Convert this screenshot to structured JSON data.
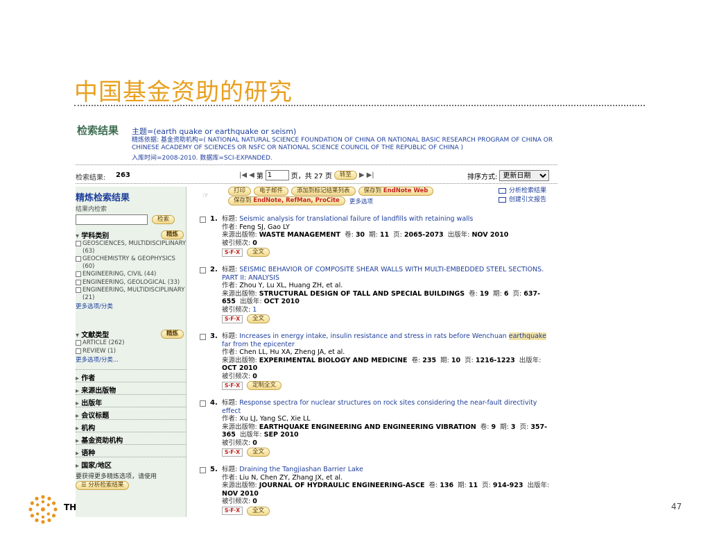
{
  "slide": {
    "title": "中国基金资助的研究",
    "logo_text": "TH",
    "page_number": "47"
  },
  "header": {
    "title": "检索结果",
    "topic": "主题=(earth quake or earthquake or seism)",
    "query": "精炼依据: 基金资助机构=( NATIONAL NATURAL SCIENCE FOUNDATION OF CHINA OR NATIONAL BASIC RESEARCH PROGRAM OF CHINA OR CHINESE ACADEMY OF SCIENCES OR NSFC OR NATIONAL SCIENCE COUNCIL OF THE REPUBLIC OF CHINA )",
    "timespan": "入库时间=2008-2010. 数据库=SCI-EXPANDED."
  },
  "results_bar": {
    "count_label": "检索结果:",
    "count": "263",
    "page_prefix": "第",
    "page_value": "1",
    "page_suffix": "页，共 27 页",
    "go_label": "转至",
    "sort_label": "排序方式:",
    "sort_value": "更新日期"
  },
  "sidebar": {
    "title": "精炼检索结果",
    "subtitle": "结果内检索",
    "search_button": "检索",
    "refine_button": "精炼",
    "subject": {
      "label": "学科类别",
      "items": [
        "GEOSCIENCES, MULTIDISCIPLINARY (63)",
        "GEOCHEMISTRY & GEOPHYSICS (60)",
        "ENGINEERING, CIVIL (44)",
        "ENGINEERING, GEOLOGICAL (33)",
        "ENGINEERING, MULTIDISCIPLINARY (21)"
      ],
      "more": "更多选项/分类"
    },
    "doctype": {
      "label": "文献类型",
      "items": [
        "ARTICLE (262)",
        "REVIEW (1)"
      ],
      "more": "更多选项/分类..."
    },
    "collapsed": [
      "作者",
      "来源出版物",
      "出版年",
      "会议标题",
      "机构",
      "基金资助机构",
      "语种",
      "国家/地区"
    ],
    "note": "要获得更多精炼选项，请使用",
    "analyze_button": "分析检索结果"
  },
  "actions": {
    "print": "打印",
    "email": "电子邮件",
    "add_marked": "添加到标记结果列表",
    "save_to": "保存到",
    "endnote_web": "EndNote Web",
    "save_to2": "保存到",
    "endnote_refman": "EndNote, RefMan, ProCite",
    "more_options": "更多选项",
    "analyze_results": "分析检索结果",
    "citation_report": "创建引文报告"
  },
  "labels": {
    "title": "标题:",
    "authors": "作者:",
    "source": "来源出版物:",
    "volume": "卷:",
    "issue": "期:",
    "pages": "页:",
    "year": "出版年:",
    "cited": "被引频次:",
    "sfx": "S·F·X",
    "fulltext": "全文",
    "custom_fulltext": "定制全文"
  },
  "records": [
    {
      "num": "1.",
      "title": "Seismic analysis for translational failure of landfills with retaining walls",
      "authors": "Feng SJ, Gao LY",
      "source": "WASTE MANAGEMENT",
      "volume": "30",
      "issue": "11",
      "pages": "2065-2073",
      "year": "NOV 2010",
      "cited": "0",
      "button": "全文"
    },
    {
      "num": "2.",
      "title": "SEISMIC BEHAVIOR OF COMPOSITE SHEAR WALLS WITH MULTI-EMBEDDED STEEL SECTIONS. PART II: ANALYSIS",
      "authors": "Zhou Y, Lu XL, Huang ZH, et al.",
      "source": "STRUCTURAL DESIGN OF TALL AND SPECIAL BUILDINGS",
      "volume": "19",
      "issue": "6",
      "pages": "637-655",
      "year": "OCT 2010",
      "cited": "1",
      "button": "全文"
    },
    {
      "num": "3.",
      "title_pre": "Increases in energy intake, insulin resistance and stress in rats before Wenchuan",
      "title_hl": "earthquake",
      "title_post": "far from the epicenter",
      "authors": "Chen LL, Hu XA, Zheng JA, et al.",
      "source": "EXPERIMENTAL BIOLOGY AND MEDICINE",
      "volume": "235",
      "issue": "10",
      "pages": "1216-1223",
      "year": "OCT 2010",
      "cited": "0",
      "button": "定制全文"
    },
    {
      "num": "4.",
      "title": "Response spectra for nuclear structures on rock sites considering the near-fault directivity effect",
      "authors": "Xu LJ, Yang SC, Xie LL",
      "source": "EARTHQUAKE ENGINEERING AND ENGINEERING VIBRATION",
      "volume": "9",
      "issue": "3",
      "pages": "357-365",
      "year": "SEP 2010",
      "cited": "0",
      "button": "全文"
    },
    {
      "num": "5.",
      "title": "Draining the Tangjiashan Barrier Lake",
      "authors": "Liu N, Chen ZY, Zhang JX, et al.",
      "source": "JOURNAL OF HYDRAULIC ENGINEERING-ASCE",
      "volume": "136",
      "issue": "11",
      "pages": "914-923",
      "year": "NOV 2010",
      "cited": "0",
      "button": "全文"
    }
  ]
}
